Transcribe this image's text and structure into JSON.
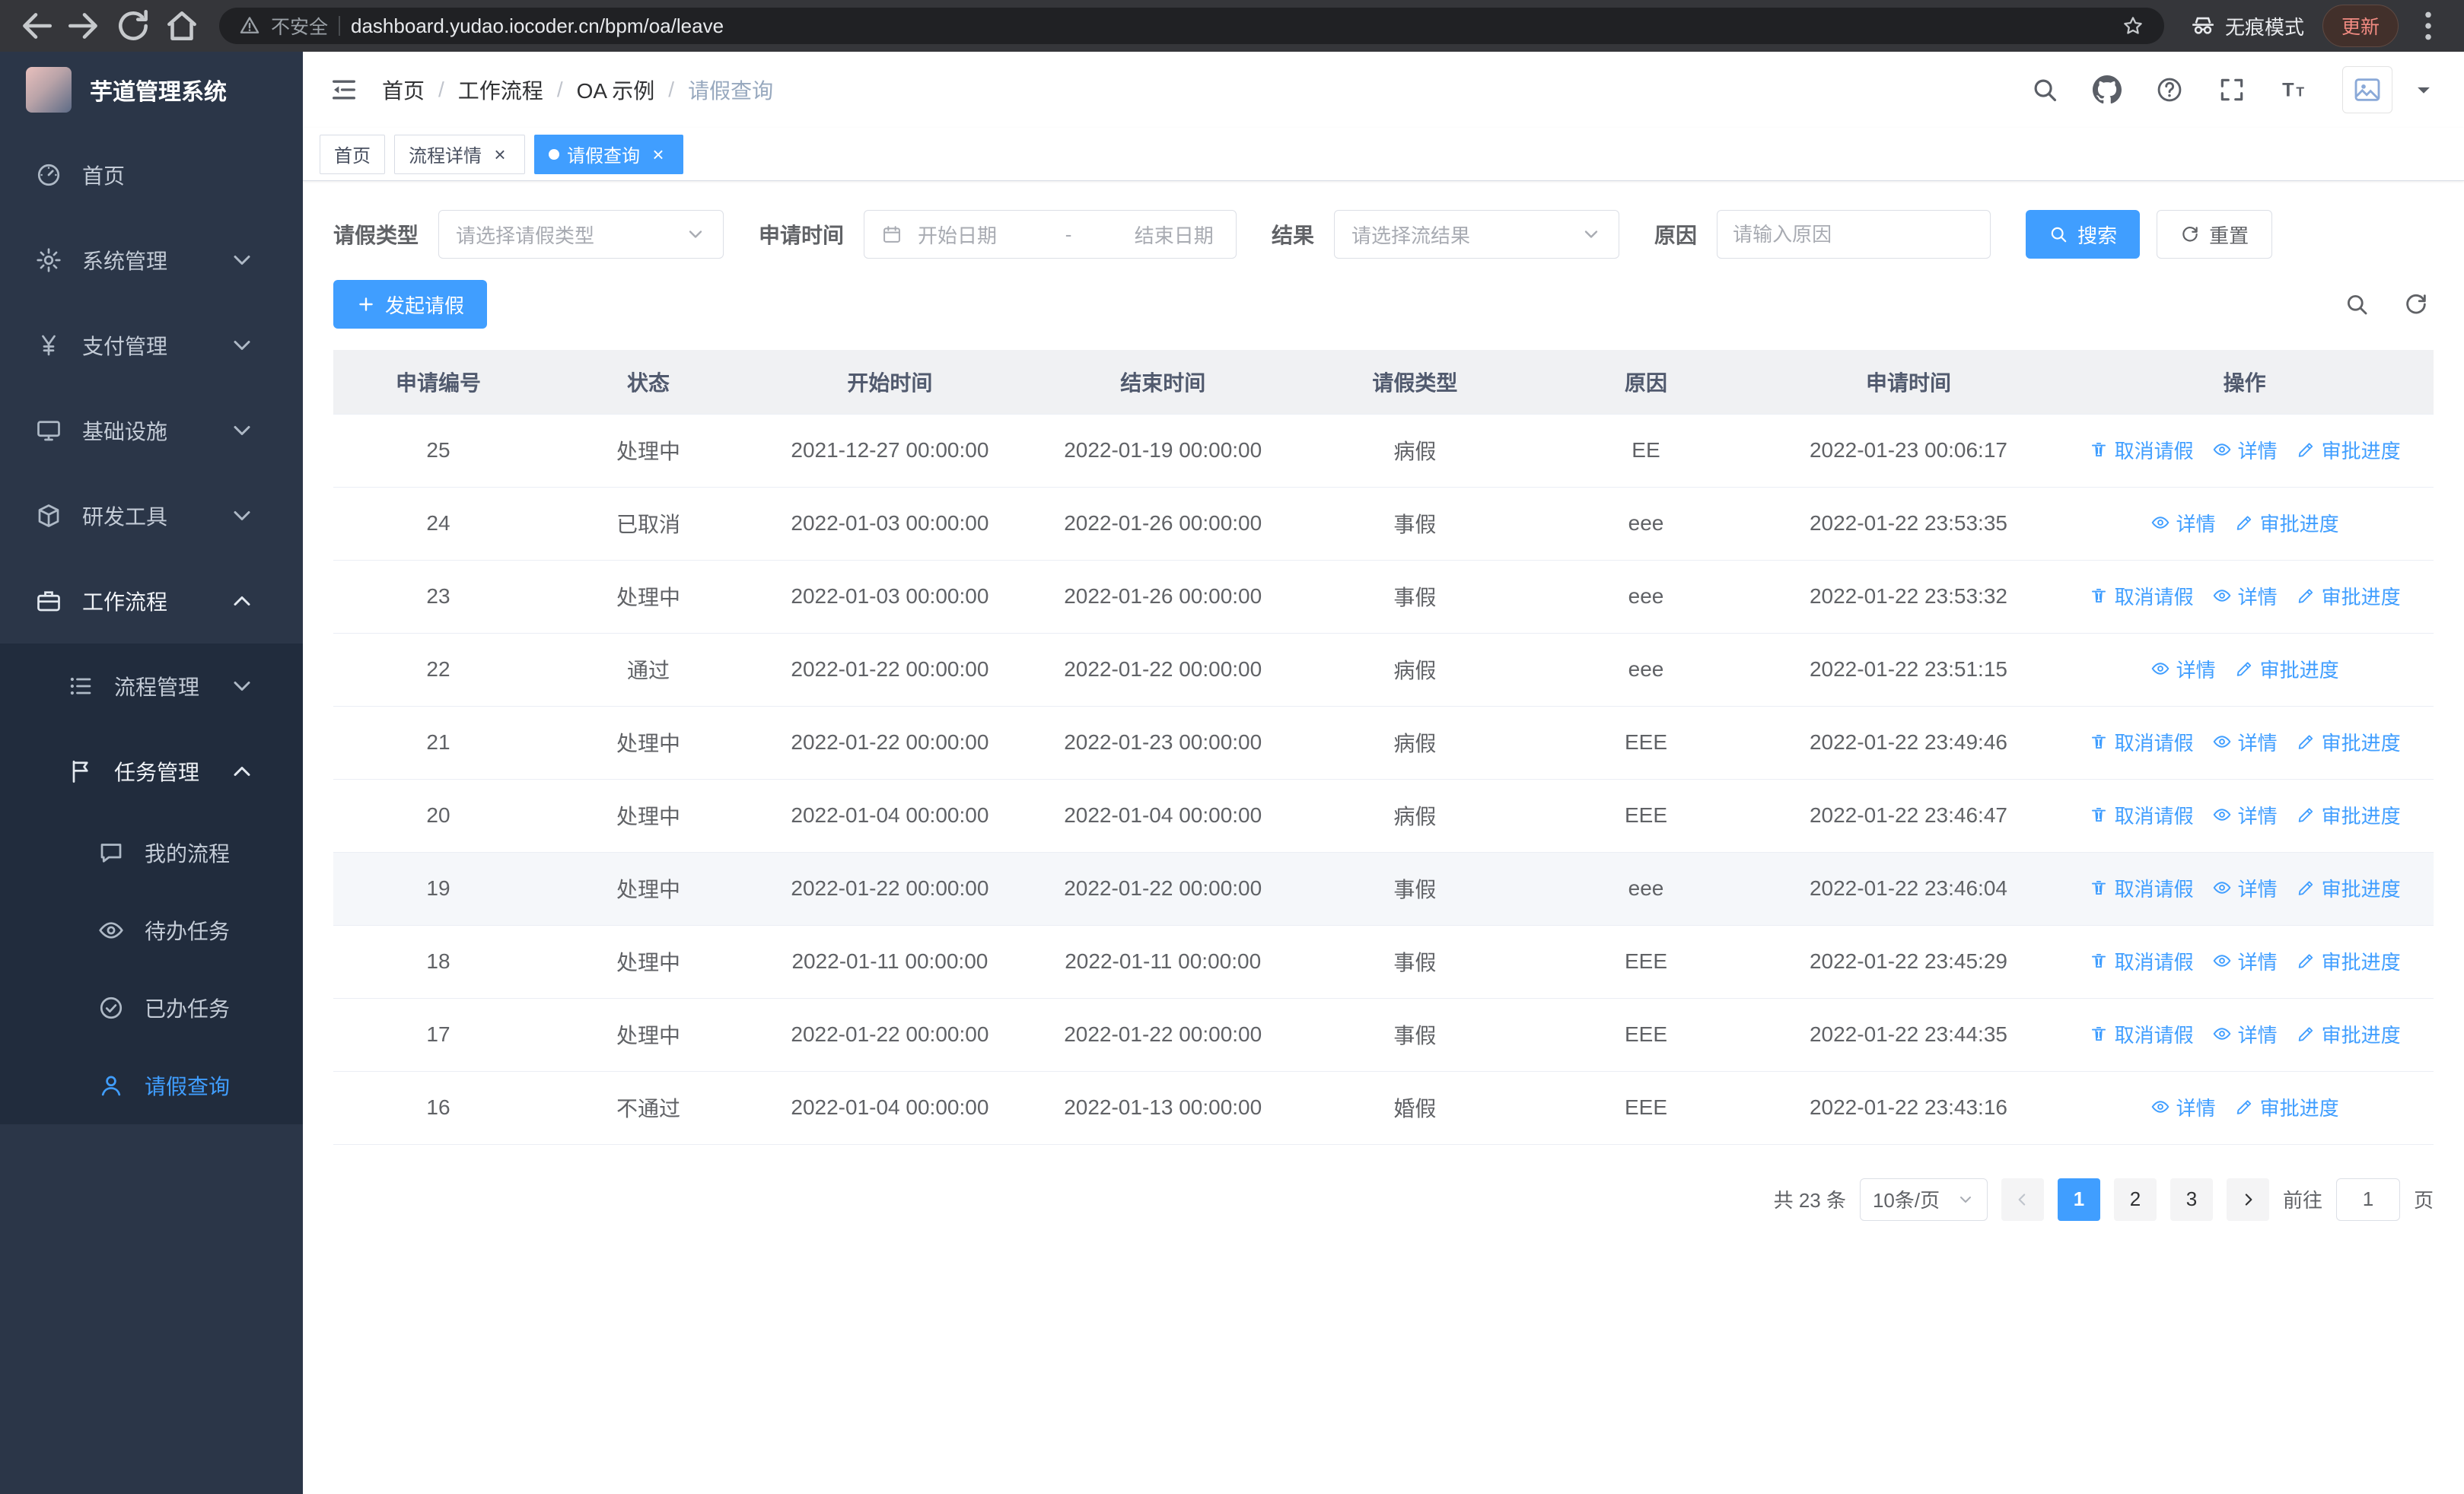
{
  "browser": {
    "security_label": "不安全",
    "url": "dashboard.yudao.iocoder.cn/bpm/oa/leave",
    "incognito_label": "无痕模式",
    "update_label": "更新"
  },
  "sidebar": {
    "logo_title": "芋道管理系统",
    "menu": [
      {
        "id": "home",
        "icon": "dashboard",
        "label": "首页"
      },
      {
        "id": "system-mgmt",
        "icon": "gear",
        "label": "系统管理",
        "expandable": true
      },
      {
        "id": "payment-mgmt",
        "icon": "yen",
        "label": "支付管理",
        "expandable": true
      },
      {
        "id": "infrastructure",
        "icon": "monitor",
        "label": "基础设施",
        "expandable": true
      },
      {
        "id": "dev-tools",
        "icon": "cube",
        "label": "研发工具",
        "expandable": true
      },
      {
        "id": "workflow",
        "icon": "briefcase",
        "label": "工作流程",
        "expandable": true,
        "expanded": true,
        "children": [
          {
            "id": "process-mgmt",
            "icon": "list",
            "label": "流程管理",
            "expandable": true
          },
          {
            "id": "task-mgmt",
            "icon": "flag",
            "label": "任务管理",
            "expandable": true,
            "expanded": true,
            "children": [
              {
                "id": "my-processes",
                "icon": "chat",
                "label": "我的流程"
              },
              {
                "id": "todo-tasks",
                "icon": "eye",
                "label": "待办任务"
              },
              {
                "id": "done-tasks",
                "icon": "check-circle",
                "label": "已办任务"
              },
              {
                "id": "leave-query",
                "icon": "user",
                "label": "请假查询",
                "active": true
              }
            ]
          }
        ]
      }
    ]
  },
  "header": {
    "breadcrumb": [
      "首页",
      "工作流程",
      "OA 示例",
      "请假查询"
    ],
    "separator": "/"
  },
  "tabs": [
    {
      "id": "home",
      "label": "首页"
    },
    {
      "id": "process-detail",
      "label": "流程详情",
      "closable": true
    },
    {
      "id": "leave-query",
      "label": "请假查询",
      "closable": true,
      "active": true
    }
  ],
  "filters": {
    "leave_type_label": "请假类型",
    "leave_type_placeholder": "请选择请假类型",
    "apply_time_label": "申请时间",
    "start_date_placeholder": "开始日期",
    "date_separator": "-",
    "end_date_placeholder": "结束日期",
    "result_label": "结果",
    "result_placeholder": "请选择流结果",
    "reason_label": "原因",
    "reason_placeholder": "请输入原因",
    "search_label": "搜索",
    "reset_label": "重置"
  },
  "toolbar": {
    "create_label": "发起请假"
  },
  "table": {
    "columns": [
      "申请编号",
      "状态",
      "开始时间",
      "结束时间",
      "请假类型",
      "原因",
      "申请时间",
      "操作"
    ],
    "action_labels": {
      "cancel": "取消请假",
      "detail": "详情",
      "progress": "审批进度"
    },
    "rows": [
      {
        "id": "25",
        "status": "处理中",
        "start_time": "2021-12-27 00:00:00",
        "end_time": "2022-01-19 00:00:00",
        "leave_type": "病假",
        "reason": "EE",
        "apply_time": "2022-01-23 00:06:17",
        "actions": [
          "cancel",
          "detail",
          "progress"
        ]
      },
      {
        "id": "24",
        "status": "已取消",
        "start_time": "2022-01-03 00:00:00",
        "end_time": "2022-01-26 00:00:00",
        "leave_type": "事假",
        "reason": "eee",
        "apply_time": "2022-01-22 23:53:35",
        "actions": [
          "detail",
          "progress"
        ]
      },
      {
        "id": "23",
        "status": "处理中",
        "start_time": "2022-01-03 00:00:00",
        "end_time": "2022-01-26 00:00:00",
        "leave_type": "事假",
        "reason": "eee",
        "apply_time": "2022-01-22 23:53:32",
        "actions": [
          "cancel",
          "detail",
          "progress"
        ]
      },
      {
        "id": "22",
        "status": "通过",
        "start_time": "2022-01-22 00:00:00",
        "end_time": "2022-01-22 00:00:00",
        "leave_type": "病假",
        "reason": "eee",
        "apply_time": "2022-01-22 23:51:15",
        "actions": [
          "detail",
          "progress"
        ]
      },
      {
        "id": "21",
        "status": "处理中",
        "start_time": "2022-01-22 00:00:00",
        "end_time": "2022-01-23 00:00:00",
        "leave_type": "病假",
        "reason": "EEE",
        "apply_time": "2022-01-22 23:49:46",
        "actions": [
          "cancel",
          "detail",
          "progress"
        ]
      },
      {
        "id": "20",
        "status": "处理中",
        "start_time": "2022-01-04 00:00:00",
        "end_time": "2022-01-04 00:00:00",
        "leave_type": "病假",
        "reason": "EEE",
        "apply_time": "2022-01-22 23:46:47",
        "actions": [
          "cancel",
          "detail",
          "progress"
        ]
      },
      {
        "id": "19",
        "status": "处理中",
        "start_time": "2022-01-22 00:00:00",
        "end_time": "2022-01-22 00:00:00",
        "leave_type": "事假",
        "reason": "eee",
        "apply_time": "2022-01-22 23:46:04",
        "actions": [
          "cancel",
          "detail",
          "progress"
        ],
        "highlighted": true
      },
      {
        "id": "18",
        "status": "处理中",
        "start_time": "2022-01-11 00:00:00",
        "end_time": "2022-01-11 00:00:00",
        "leave_type": "事假",
        "reason": "EEE",
        "apply_time": "2022-01-22 23:45:29",
        "actions": [
          "cancel",
          "detail",
          "progress"
        ]
      },
      {
        "id": "17",
        "status": "处理中",
        "start_time": "2022-01-22 00:00:00",
        "end_time": "2022-01-22 00:00:00",
        "leave_type": "事假",
        "reason": "EEE",
        "apply_time": "2022-01-22 23:44:35",
        "actions": [
          "cancel",
          "detail",
          "progress"
        ]
      },
      {
        "id": "16",
        "status": "不通过",
        "start_time": "2022-01-04 00:00:00",
        "end_time": "2022-01-13 00:00:00",
        "leave_type": "婚假",
        "reason": "EEE",
        "apply_time": "2022-01-22 23:43:16",
        "actions": [
          "detail",
          "progress"
        ]
      }
    ]
  },
  "pagination": {
    "total": "共 23 条",
    "page_size": "10条/页",
    "pages": [
      "1",
      "2",
      "3"
    ],
    "active_page": "1",
    "goto_label": "前往",
    "goto_value": "1",
    "page_label": "页"
  },
  "colors": {
    "primary": "#409eff",
    "sidebar_bg": "#2b3648",
    "submenu_bg": "#212c3d"
  }
}
